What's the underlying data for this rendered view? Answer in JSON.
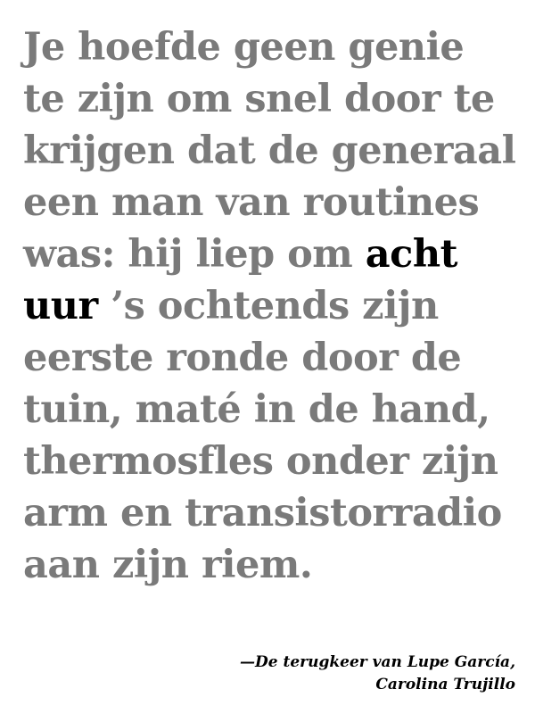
{
  "quote": {
    "line1": "Je hoefde geen genie",
    "line2": "te zijn om snel door te",
    "line3": "krijgen dat de generaal",
    "line4": "een man van routines",
    "line5_before": "was: hij liep om ",
    "line5_highlight": "acht",
    "line6_highlight": "uur",
    "line6_after": " ’s ochtends zijn",
    "line7": "eerste ronde door de",
    "line8": "tuin, maté in de hand,",
    "line9": "thermosfles onder zijn",
    "line10": "arm en transistorradio",
    "line11": "aan zijn riem."
  },
  "attribution": {
    "line1": "—De terugkeer van Lupe García,",
    "line2": "Carolina Trujillo"
  },
  "colors": {
    "body_text": "#7a7a7a",
    "highlight": "#000000",
    "background": "#ffffff"
  }
}
